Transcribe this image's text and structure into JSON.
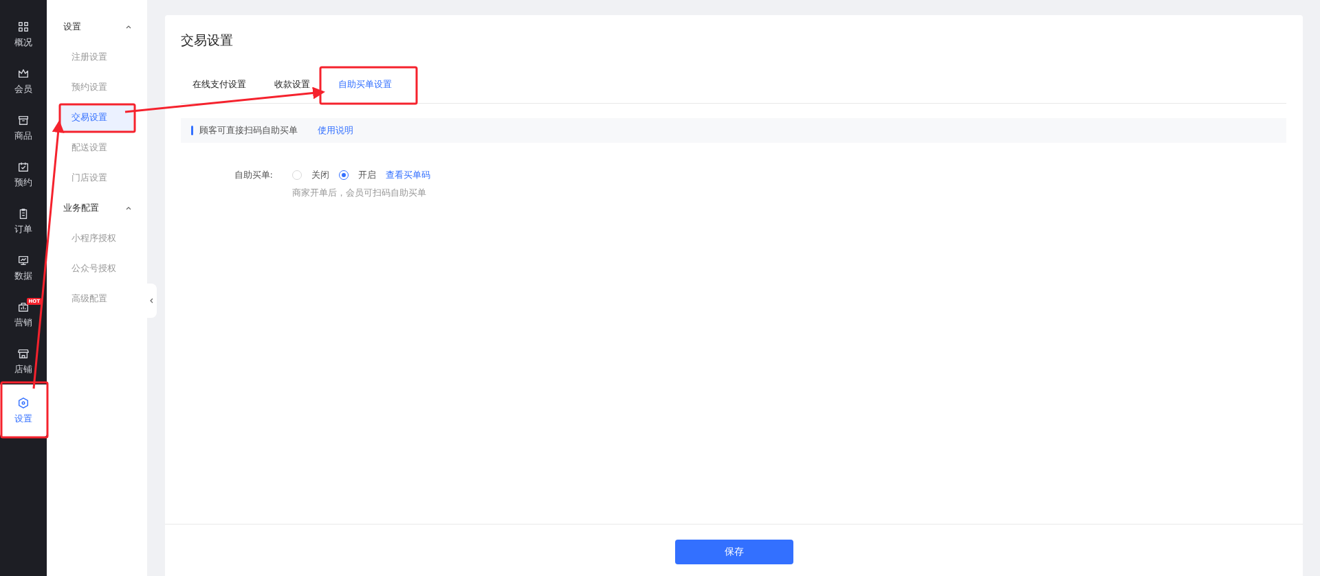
{
  "nav": [
    {
      "label": "概况",
      "selected": false
    },
    {
      "label": "会员",
      "selected": false
    },
    {
      "label": "商品",
      "selected": false
    },
    {
      "label": "预约",
      "selected": false
    },
    {
      "label": "订单",
      "selected": false
    },
    {
      "label": "数据",
      "selected": false
    },
    {
      "label": "营销",
      "selected": false,
      "badge": "HOT"
    },
    {
      "label": "店铺",
      "selected": false
    },
    {
      "label": "设置",
      "selected": true
    }
  ],
  "submenu": [
    {
      "title": "设置",
      "expanded": true,
      "children": [
        {
          "label": "注册设置",
          "selected": false
        },
        {
          "label": "预约设置",
          "selected": false
        },
        {
          "label": "交易设置",
          "selected": true
        },
        {
          "label": "配送设置",
          "selected": false
        },
        {
          "label": "门店设置",
          "selected": false
        }
      ]
    },
    {
      "title": "业务配置",
      "expanded": true,
      "children": [
        {
          "label": "小程序授权",
          "selected": false
        },
        {
          "label": "公众号授权",
          "selected": false
        },
        {
          "label": "高级配置",
          "selected": false
        }
      ]
    }
  ],
  "page": {
    "title": "交易设置",
    "tabs": [
      {
        "label": "在线支付设置",
        "selected": false
      },
      {
        "label": "收款设置",
        "selected": false
      },
      {
        "label": "自助买单设置",
        "selected": true
      }
    ],
    "notice": {
      "text": "顾客可直接扫码自助买单",
      "link": "使用说明"
    },
    "form": {
      "label": "自助买单:",
      "options": [
        {
          "label": "关闭",
          "selected": false
        },
        {
          "label": "开启",
          "selected": true
        }
      ],
      "link": "查看买单码",
      "hint": "商家开单后，会员可扫码自助买单"
    },
    "save_button": "保存"
  }
}
